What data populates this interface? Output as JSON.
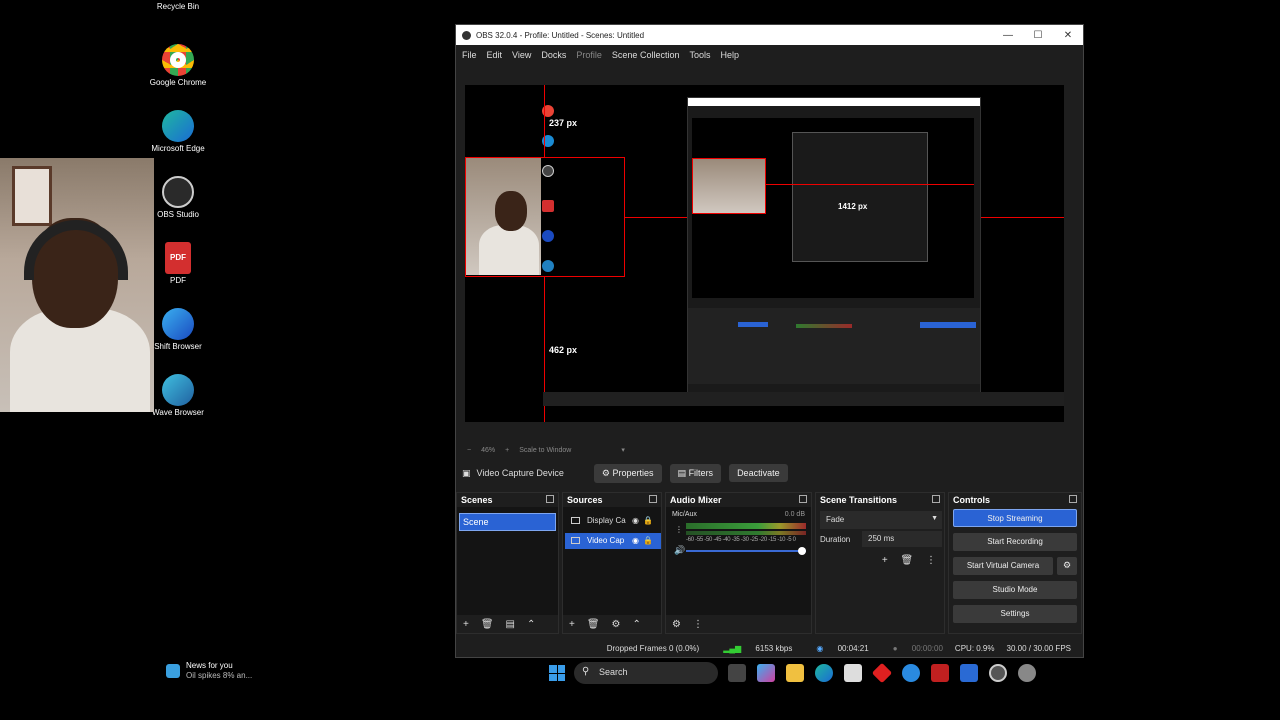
{
  "desktop": {
    "icons": [
      {
        "label": "Recycle Bin"
      },
      {
        "label": "Google Chrome"
      },
      {
        "label": "Microsoft Edge"
      },
      {
        "label": "OBS Studio"
      },
      {
        "label": "PDF"
      },
      {
        "label": "Shift Browser"
      },
      {
        "label": "Wave Browser"
      }
    ]
  },
  "obs": {
    "title": "OBS 32.0.4 - Profile: Untitled - Scenes: Untitled",
    "menu": [
      "File",
      "Edit",
      "View",
      "Docks",
      "Profile",
      "Scene Collection",
      "Tools",
      "Help"
    ],
    "preview": {
      "measure_top": "237 px",
      "measure_bottom": "462 px",
      "measure_right": "1412 px"
    },
    "scalebar": {
      "zoom": "46%",
      "scale_mode": "Scale to Window"
    },
    "source_toolbar": {
      "source_name": "Video Capture Device",
      "properties": "Properties",
      "filters": "Filters",
      "deactivate": "Deactivate"
    },
    "docks": {
      "scenes": {
        "title": "Scenes",
        "items": [
          "Scene"
        ]
      },
      "sources": {
        "title": "Sources",
        "items": [
          "Display Ca",
          "Video Cap"
        ]
      },
      "mixer": {
        "title": "Audio Mixer",
        "channel": "Mic/Aux",
        "db": "0.0 dB",
        "ticks": "-60 -55 -50 -45 -40 -35 -30 -25 -20 -15 -10 -5 0"
      },
      "transitions": {
        "title": "Scene Transitions",
        "selected": "Fade",
        "duration_label": "Duration",
        "duration_value": "250 ms"
      },
      "controls": {
        "title": "Controls",
        "stop_streaming": "Stop Streaming",
        "start_recording": "Start Recording",
        "start_virtual_camera": "Start Virtual Camera",
        "studio_mode": "Studio Mode",
        "settings": "Settings"
      }
    },
    "status": {
      "dropped": "Dropped Frames 0 (0.0%)",
      "bitrate": "6153 kbps",
      "stream_time": "00:04:21",
      "rec_time": "00:00:00",
      "cpu": "CPU: 0.9%",
      "fps": "30.00 / 30.00 FPS"
    }
  },
  "taskbar": {
    "news_title": "News for you",
    "news_sub": "Oil spikes 8% an...",
    "search": "Search"
  },
  "colors": {
    "accent": "#2a63d4",
    "selection_red": "#e00000"
  }
}
